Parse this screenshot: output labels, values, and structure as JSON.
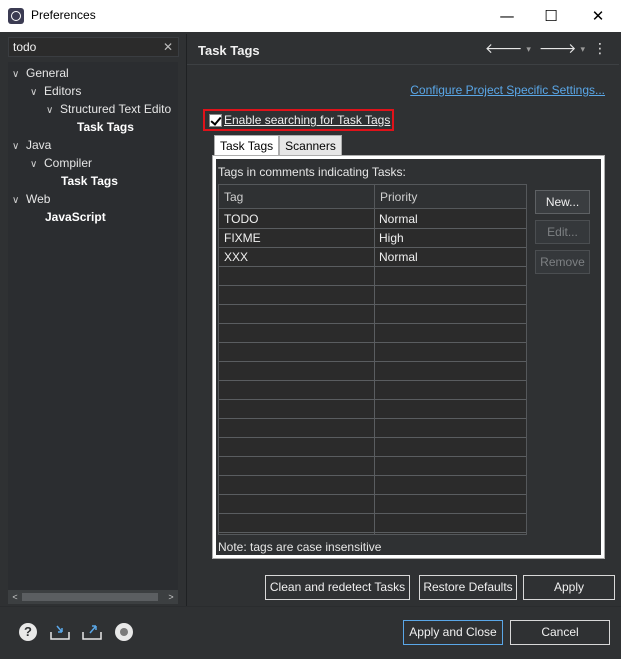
{
  "window": {
    "title": "Preferences",
    "minimize_glyph": "—",
    "maximize_glyph": "☐",
    "close_glyph": "✕"
  },
  "left": {
    "filter_value": "todo",
    "filter_clear_glyph": "✕",
    "tree": [
      {
        "label": "General",
        "chevron": "∨"
      },
      {
        "label": "Editors",
        "chevron": "∨"
      },
      {
        "label": "Structured Text Edito",
        "chevron": "∨"
      },
      {
        "label": "Task Tags",
        "chevron": ""
      },
      {
        "label": "Java",
        "chevron": "∨"
      },
      {
        "label": "Compiler",
        "chevron": "∨"
      },
      {
        "label": "Task Tags",
        "chevron": ""
      },
      {
        "label": "Web",
        "chevron": "∨"
      },
      {
        "label": "JavaScript",
        "chevron": ""
      }
    ],
    "scroll_left": "<",
    "scroll_right": ">"
  },
  "right": {
    "title": "Task Tags",
    "nav": {
      "back": "🡐",
      "forward": "🡒",
      "dropdown": "▾",
      "menu": "⋮"
    },
    "configure_link": "Configure Project Specific Settings...",
    "enable_label": "Enable searching for Task Tags",
    "tabs": [
      "Task Tags",
      "Scanners"
    ],
    "tags_heading": "Tags in comments indicating Tasks:",
    "table": {
      "headers": [
        "Tag",
        "Priority"
      ],
      "rows": [
        {
          "tag": "TODO",
          "priority": "Normal"
        },
        {
          "tag": "FIXME",
          "priority": "High"
        },
        {
          "tag": "XXX",
          "priority": "Normal"
        }
      ]
    },
    "buttons": {
      "new": "New...",
      "edit": "Edit...",
      "remove": "Remove"
    },
    "note": "Note: tags are case insensitive",
    "bottom_buttons": {
      "clean": "Clean and redetect Tasks",
      "restore": "Restore Defaults",
      "apply": "Apply"
    }
  },
  "footer": {
    "help_glyph": "?",
    "apply_close": "Apply and Close",
    "cancel": "Cancel"
  }
}
